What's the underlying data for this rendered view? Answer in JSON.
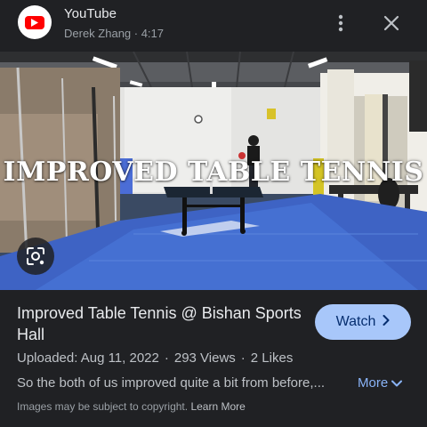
{
  "header": {
    "source_name": "YouTube",
    "meta_line": "Derek Zhang · 4:17",
    "logo_icon": "youtube-logo",
    "menu_icon": "more-vert-icon",
    "close_icon": "close-icon"
  },
  "media": {
    "overlay_text": "IMPROVED TABLE TENNIS",
    "lens_icon": "google-lens-icon"
  },
  "result": {
    "title": "Improved Table Tennis @ Bishan Sports Hall",
    "watch_label": "Watch",
    "uploaded": "Uploaded: Aug 11, 2022",
    "views": "293 Views",
    "likes": "2 Likes",
    "separator": "·",
    "description": "So the both of us improved quite a bit from before,...",
    "more_label": "More",
    "copyright_text": "Images may be subject to copyright.",
    "learn_more": "Learn More"
  },
  "colors": {
    "background": "#202124",
    "watch_button": "#a8c7fa",
    "link": "#8ab4f8",
    "youtube_red": "#ff0000"
  }
}
